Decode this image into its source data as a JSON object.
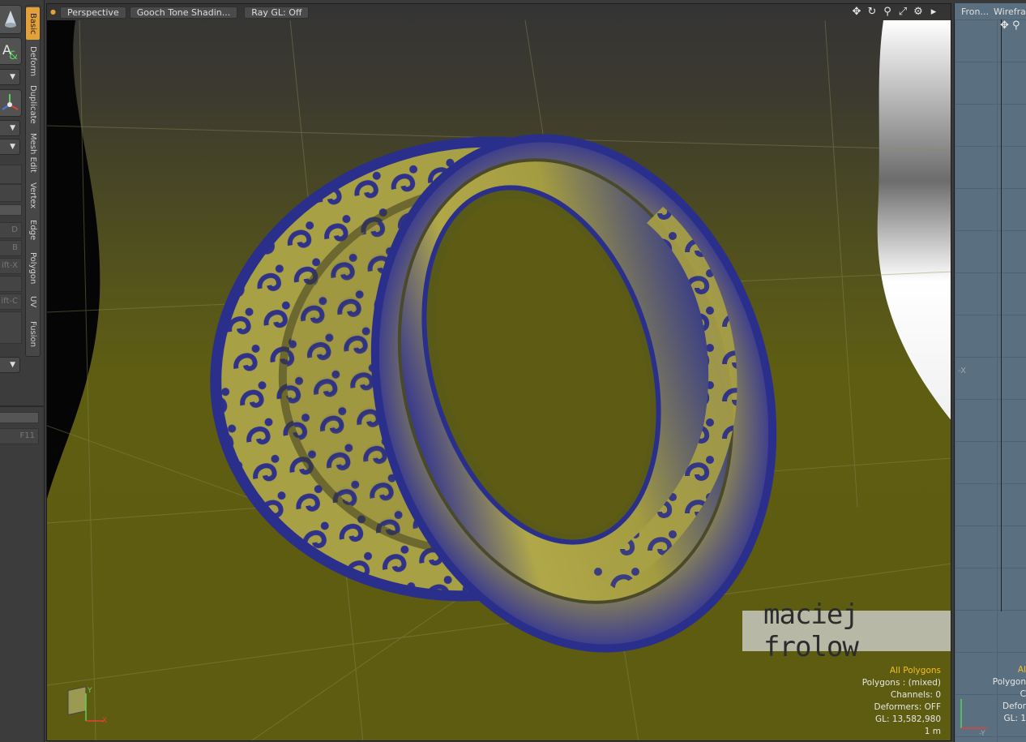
{
  "toolbox": {
    "vertical_tabs": [
      "Basic",
      "Deform",
      "Duplicate",
      "Mesh Edit",
      "Vertex",
      "Edge",
      "Polygon",
      "UV",
      "Fusion"
    ],
    "active_tab": "Basic",
    "key_labels": [
      "D",
      "B",
      "ift-X",
      "ift-C",
      "F11"
    ]
  },
  "viewport": {
    "view_label": "Perspective",
    "shading_label": "Gooch Tone Shadin...",
    "raygl_label": "Ray GL: Off",
    "tools": [
      "move-icon",
      "rotate-icon",
      "zoom-icon",
      "fit-icon",
      "settings-icon",
      "expand-icon"
    ],
    "stats": {
      "selection": "All Polygons",
      "polygons": "Polygons : (mixed)",
      "channels": "Channels: 0",
      "deformers": "Deformers: OFF",
      "gl": "GL: 13,582,980",
      "scale": "1 m"
    },
    "axis_labels": {
      "y": "Y",
      "x": "X"
    },
    "watermark": "maciej frolow"
  },
  "side_view": {
    "view_label": "Fron...",
    "shading_label": "Wirefra...",
    "axis_label": "-X",
    "axis_label_bottom": "-Y",
    "stats": {
      "selection": "Al",
      "polygons": "Polygon",
      "channels": "C",
      "deformers": "Defor",
      "gl": "GL: 1"
    }
  },
  "colors": {
    "accent": "#e4a13a",
    "mesh_yellow": "#b8b048",
    "wire_blue": "#2a2f8c",
    "ground": "#5e5c10",
    "selection_text": "#f0c020"
  }
}
